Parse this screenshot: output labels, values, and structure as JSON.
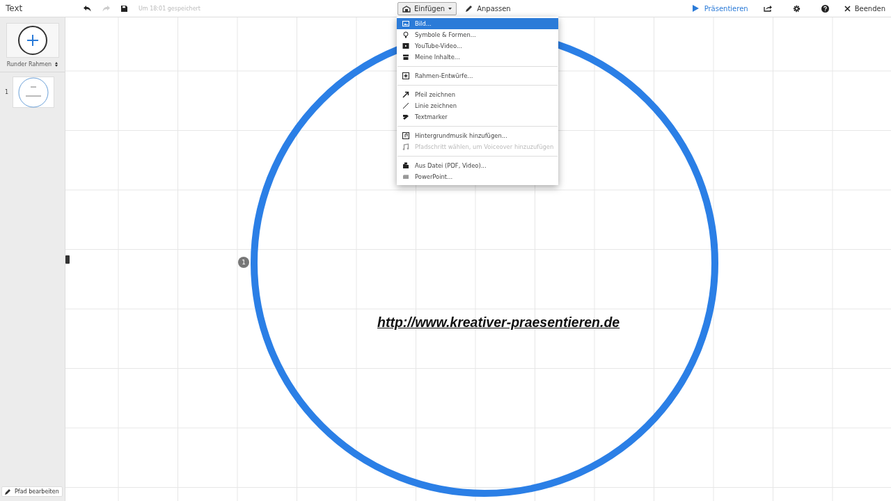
{
  "toolbar": {
    "title": "Text",
    "save_status": "Um 18:01 gespeichert",
    "undo_enabled": true,
    "redo_enabled": false,
    "insert_label": "Einfügen",
    "insert_open": true,
    "customize_label": "Anpassen",
    "present_label": "Präsentieren",
    "exit_label": "Beenden"
  },
  "sidebar": {
    "frame_type": "Runder Rahmen",
    "steps": [
      {
        "number": "1",
        "selected": false
      }
    ],
    "edit_path_label": "Pfad bearbeiten"
  },
  "canvas": {
    "step_marker": "1",
    "link": "http://www.kreativer-praesentieren.de"
  },
  "insert_menu": {
    "groups": [
      [
        {
          "label": "Bild...",
          "selected": true,
          "disabled": false
        },
        {
          "label": "Symbole & Formen...",
          "selected": false,
          "disabled": false
        },
        {
          "label": "YouTube-Video...",
          "selected": false,
          "disabled": false
        },
        {
          "label": "Meine Inhalte...",
          "selected": false,
          "disabled": false
        }
      ],
      [
        {
          "label": "Rahmen-Entwürfe...",
          "selected": false,
          "disabled": false
        }
      ],
      [
        {
          "label": "Pfeil zeichnen",
          "selected": false,
          "disabled": false
        },
        {
          "label": "Linie zeichnen",
          "selected": false,
          "disabled": false
        },
        {
          "label": "Textmarker",
          "selected": false,
          "disabled": false
        }
      ],
      [
        {
          "label": "Hintergrundmusik hinzufügen...",
          "selected": false,
          "disabled": false
        },
        {
          "label": "Pfadschritt wählen, um Voiceover hinzuzufügen",
          "selected": false,
          "disabled": true
        }
      ],
      [
        {
          "label": "Aus Datei (PDF, Video)...",
          "selected": false,
          "disabled": false
        },
        {
          "label": "PowerPoint...",
          "selected": false,
          "disabled": false
        }
      ]
    ]
  }
}
